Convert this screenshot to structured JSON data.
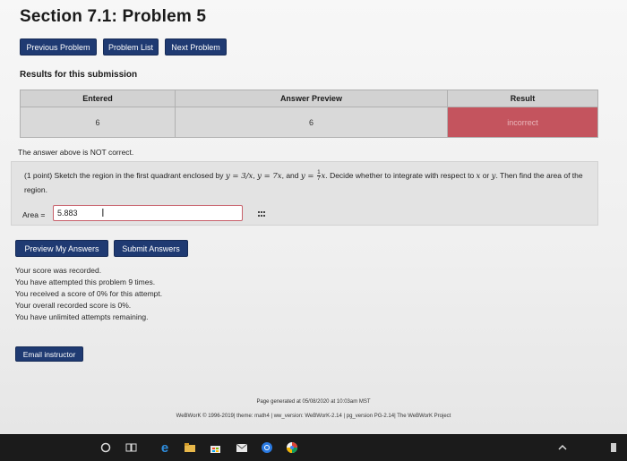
{
  "page": {
    "title": "Section 7.1: Problem 5"
  },
  "nav": {
    "previous": "Previous Problem",
    "list": "Problem List",
    "next": "Next Problem"
  },
  "results": {
    "heading": "Results for this submission",
    "columns": [
      "Entered",
      "Answer Preview",
      "Result"
    ],
    "row": {
      "entered": "6",
      "preview": "6",
      "result": "incorrect"
    },
    "message": "The answer above is NOT correct."
  },
  "problem": {
    "prefix": "(1 point) Sketch the region in the first quadrant enclosed by ",
    "eq1": "y = 3/x",
    "sep1": ", ",
    "eq2": "y = 7x",
    "sep2": ", and ",
    "eq3_lhs": "y = ",
    "eq3_num": "1",
    "eq3_den": "7",
    "eq3_var": "x",
    "middle": ". Decide whether to integrate with respect to ",
    "var_x": "x",
    "or_text": " or ",
    "var_y": "y",
    "suffix": ". Then find the area of the region.",
    "answer_label": "Area =",
    "answer_value": "5.883"
  },
  "actions": {
    "preview": "Preview My Answers",
    "submit": "Submit Answers"
  },
  "status": {
    "line1": "Your score was recorded.",
    "line2": "You have attempted this problem 9 times.",
    "line3": "You received a score of 0% for this attempt.",
    "line4": "Your overall recorded score is 0%.",
    "line5": "You have unlimited attempts remaining."
  },
  "email": {
    "label": "Email instructor"
  },
  "footer": {
    "generated": "Page generated at 05/08/2020 at 10:03am MST",
    "credits": "WeBWorK © 1996-2019| theme: math4 | ww_version: WeBWorK-2.14 | pg_version PG-2.14| The WeBWorK Project"
  },
  "colors": {
    "button": "#1f3a72",
    "incorrect": "#c4545e",
    "taskbar": "#1b1b1b"
  },
  "taskbar": {
    "icons": [
      "start-circle-icon",
      "task-view-icon",
      "edge-browser-icon",
      "file-explorer-icon",
      "store-bag-icon",
      "mail-icon",
      "chrome-icon",
      "photos-icon",
      "chevron-up-icon"
    ]
  }
}
